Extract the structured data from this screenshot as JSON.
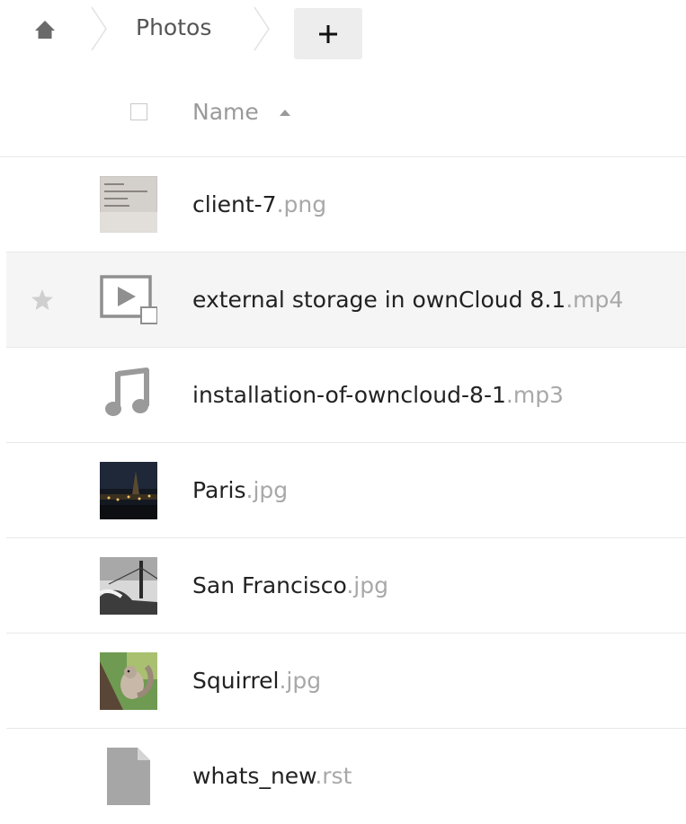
{
  "breadcrumb": {
    "home_icon": "home-icon",
    "current": "Photos",
    "new_button_icon": "plus-icon"
  },
  "header": {
    "name_label": "Name",
    "sort": "ascending"
  },
  "files": [
    {
      "name": "client-7",
      "ext": ".png",
      "icon": "image-thumbnail",
      "starred": false,
      "highlighted": false
    },
    {
      "name": "external storage in ownCloud 8.1",
      "ext": ".mp4",
      "icon": "video-icon",
      "starred": false,
      "highlighted": true
    },
    {
      "name": "installation-of-owncloud-8-1",
      "ext": ".mp3",
      "icon": "music-note-icon",
      "starred": false,
      "highlighted": false
    },
    {
      "name": "Paris",
      "ext": ".jpg",
      "icon": "image-thumbnail",
      "starred": false,
      "highlighted": false
    },
    {
      "name": "San Francisco",
      "ext": ".jpg",
      "icon": "image-thumbnail",
      "starred": false,
      "highlighted": false
    },
    {
      "name": "Squirrel",
      "ext": ".jpg",
      "icon": "image-thumbnail",
      "starred": false,
      "highlighted": false
    },
    {
      "name": "whats_new",
      "ext": ".rst",
      "icon": "document-icon",
      "starred": false,
      "highlighted": false
    }
  ],
  "colors": {
    "text": "#222222",
    "extension": "#a8a8a8",
    "icon_grey": "#9a9a9a",
    "highlight_row": "#f5f5f5"
  }
}
